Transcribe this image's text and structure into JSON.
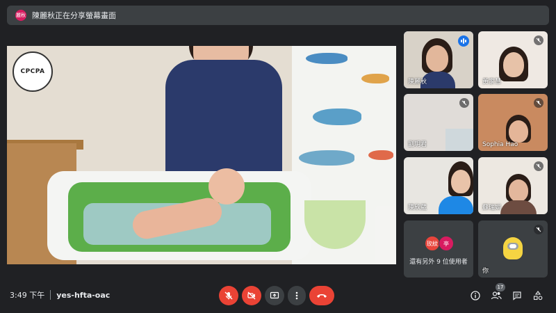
{
  "banner": {
    "avatar_text": "麗秋",
    "text": "陳麗秋正在分享螢幕畫面"
  },
  "presentation": {
    "logo_text": "CPCPA"
  },
  "participants": [
    {
      "name": "陳麗秋",
      "muted": false,
      "speaking": true
    },
    {
      "name": "黃家慧",
      "muted": true
    },
    {
      "name": "劉玥君",
      "muted": true
    },
    {
      "name": "Sophia Hao",
      "muted": true
    },
    {
      "name": "陳欣葳",
      "muted": false
    },
    {
      "name": "蘇瑞娟",
      "muted": true
    }
  ],
  "others": {
    "avatars": [
      {
        "text": "玫紋",
        "color": "#e8453c"
      },
      {
        "text": "亭",
        "color": "#d81b60"
      }
    ],
    "label": "還有另外 9 位使用者"
  },
  "self_tile": {
    "name": "你",
    "muted": true
  },
  "meeting": {
    "time": "3:49 下午",
    "code": "yes-hfta-oac"
  },
  "controls": [
    {
      "name": "mic-toggle",
      "icon": "mic-off-icon",
      "state": "off"
    },
    {
      "name": "camera-toggle",
      "icon": "camera-off-icon",
      "state": "off"
    },
    {
      "name": "present",
      "icon": "present-screen-icon"
    },
    {
      "name": "more-options",
      "icon": "more-vertical-icon"
    },
    {
      "name": "leave-call",
      "icon": "hang-up-icon"
    }
  ],
  "right_controls": {
    "people_count": "17"
  },
  "colors": {
    "background": "#202124",
    "surface": "#3c4043",
    "danger": "#ea4335",
    "accent": "#1a73e8"
  }
}
